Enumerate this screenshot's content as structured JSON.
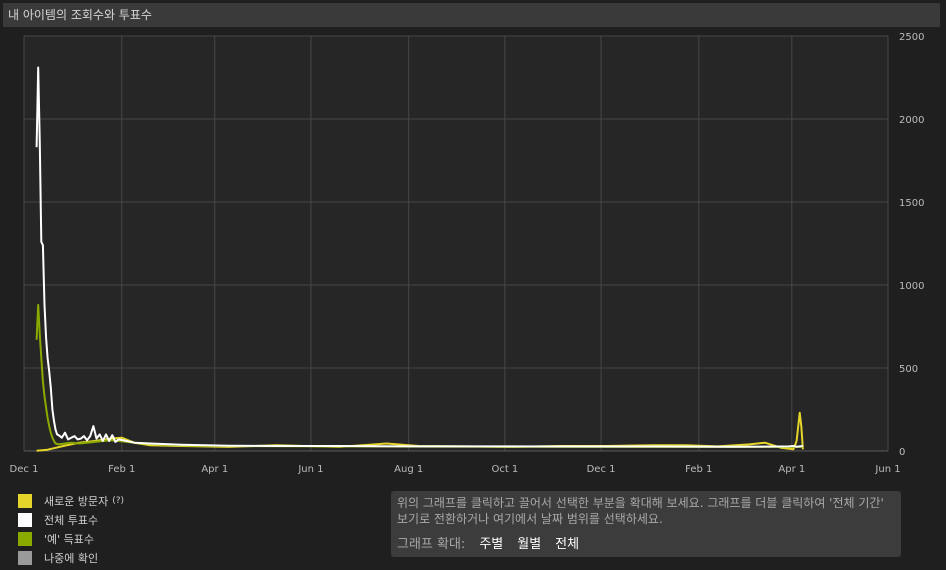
{
  "header": {
    "title": "내 아이템의 조회수와 투표수"
  },
  "legend": [
    {
      "label": "새로운 방문자",
      "suffix": "(?)",
      "color": "#e5d52a"
    },
    {
      "label": "전체 투표수",
      "color": "#ffffff"
    },
    {
      "label": "'예' 득표수",
      "color": "#8aaa00"
    },
    {
      "label": "나중에 확인",
      "color": "#9a9a9a"
    }
  ],
  "help": {
    "text": "위의 그래프를 클릭하고 끌어서 선택한 부분을 확대해 보세요. 그래프를 더블 클릭하여 '전체 기간' 보기로 전환하거나 여기에서 날짜 범위를 선택하세요.",
    "zoom_label": "그래프 확대:",
    "zoom_week": "주별",
    "zoom_month": "월별",
    "zoom_all": "전체"
  },
  "chart_data": {
    "type": "line",
    "x_ticks": [
      "Dec 1",
      "Feb 1",
      "Apr 1",
      "Jun 1",
      "Aug 1",
      "Oct 1",
      "Dec 1",
      "Feb 1",
      "Apr 1",
      "Jun 1"
    ],
    "x_tick_days": [
      0,
      62,
      121,
      182,
      244,
      305,
      366,
      428,
      487,
      548
    ],
    "y_ticks": [
      0,
      500,
      1000,
      1500,
      2000,
      2500
    ],
    "ylim": [
      0,
      2500
    ],
    "xlim": [
      0,
      548
    ],
    "grid": true,
    "series": [
      {
        "name": "전체 투표수",
        "color": "#ffffff",
        "points": [
          [
            8,
            1830
          ],
          [
            9,
            2310
          ],
          [
            10,
            1850
          ],
          [
            11,
            1260
          ],
          [
            12,
            1240
          ],
          [
            13,
            880
          ],
          [
            14,
            680
          ],
          [
            15,
            560
          ],
          [
            16,
            480
          ],
          [
            17,
            380
          ],
          [
            18,
            250
          ],
          [
            19,
            180
          ],
          [
            20,
            130
          ],
          [
            21,
            100
          ],
          [
            22,
            95
          ],
          [
            24,
            80
          ],
          [
            26,
            110
          ],
          [
            28,
            70
          ],
          [
            30,
            80
          ],
          [
            32,
            90
          ],
          [
            34,
            70
          ],
          [
            36,
            75
          ],
          [
            38,
            90
          ],
          [
            40,
            65
          ],
          [
            42,
            90
          ],
          [
            44,
            150
          ],
          [
            46,
            75
          ],
          [
            48,
            100
          ],
          [
            50,
            60
          ],
          [
            52,
            100
          ],
          [
            54,
            60
          ],
          [
            56,
            95
          ],
          [
            58,
            55
          ],
          [
            60,
            70
          ],
          [
            65,
            60
          ],
          [
            70,
            50
          ],
          [
            80,
            45
          ],
          [
            100,
            38
          ],
          [
            130,
            32
          ],
          [
            160,
            30
          ],
          [
            200,
            30
          ],
          [
            250,
            28
          ],
          [
            300,
            28
          ],
          [
            350,
            27
          ],
          [
            400,
            27
          ],
          [
            450,
            26
          ],
          [
            480,
            27
          ],
          [
            485,
            28
          ],
          [
            488,
            30
          ],
          [
            490,
            26
          ],
          [
            494,
            30
          ]
        ]
      },
      {
        "name": "'예' 득표수",
        "color": "#8aaa00",
        "points": [
          [
            8,
            670
          ],
          [
            9,
            880
          ],
          [
            10,
            700
          ],
          [
            11,
            560
          ],
          [
            12,
            420
          ],
          [
            13,
            330
          ],
          [
            14,
            260
          ],
          [
            15,
            200
          ],
          [
            16,
            150
          ],
          [
            17,
            110
          ],
          [
            18,
            80
          ],
          [
            19,
            60
          ],
          [
            20,
            45
          ],
          [
            22,
            40
          ],
          [
            26,
            45
          ],
          [
            30,
            50
          ],
          [
            35,
            45
          ],
          [
            40,
            50
          ],
          [
            45,
            55
          ],
          [
            50,
            60
          ],
          [
            55,
            65
          ],
          [
            60,
            60
          ],
          [
            70,
            50
          ],
          [
            90,
            38
          ],
          [
            120,
            30
          ],
          [
            200,
            28
          ],
          [
            300,
            26
          ],
          [
            400,
            25
          ],
          [
            494,
            25
          ]
        ]
      },
      {
        "name": "새로운 방문자",
        "color": "#e5d52a",
        "points": [
          [
            8,
            2
          ],
          [
            15,
            8
          ],
          [
            25,
            30
          ],
          [
            35,
            50
          ],
          [
            45,
            60
          ],
          [
            55,
            75
          ],
          [
            62,
            80
          ],
          [
            70,
            50
          ],
          [
            80,
            35
          ],
          [
            100,
            30
          ],
          [
            130,
            25
          ],
          [
            160,
            35
          ],
          [
            200,
            25
          ],
          [
            230,
            45
          ],
          [
            250,
            30
          ],
          [
            280,
            28
          ],
          [
            310,
            25
          ],
          [
            340,
            30
          ],
          [
            370,
            30
          ],
          [
            400,
            35
          ],
          [
            420,
            35
          ],
          [
            440,
            28
          ],
          [
            460,
            40
          ],
          [
            470,
            50
          ],
          [
            480,
            20
          ],
          [
            488,
            10
          ],
          [
            490,
            60
          ],
          [
            492,
            230
          ],
          [
            493,
            150
          ],
          [
            494,
            10
          ]
        ]
      }
    ]
  }
}
